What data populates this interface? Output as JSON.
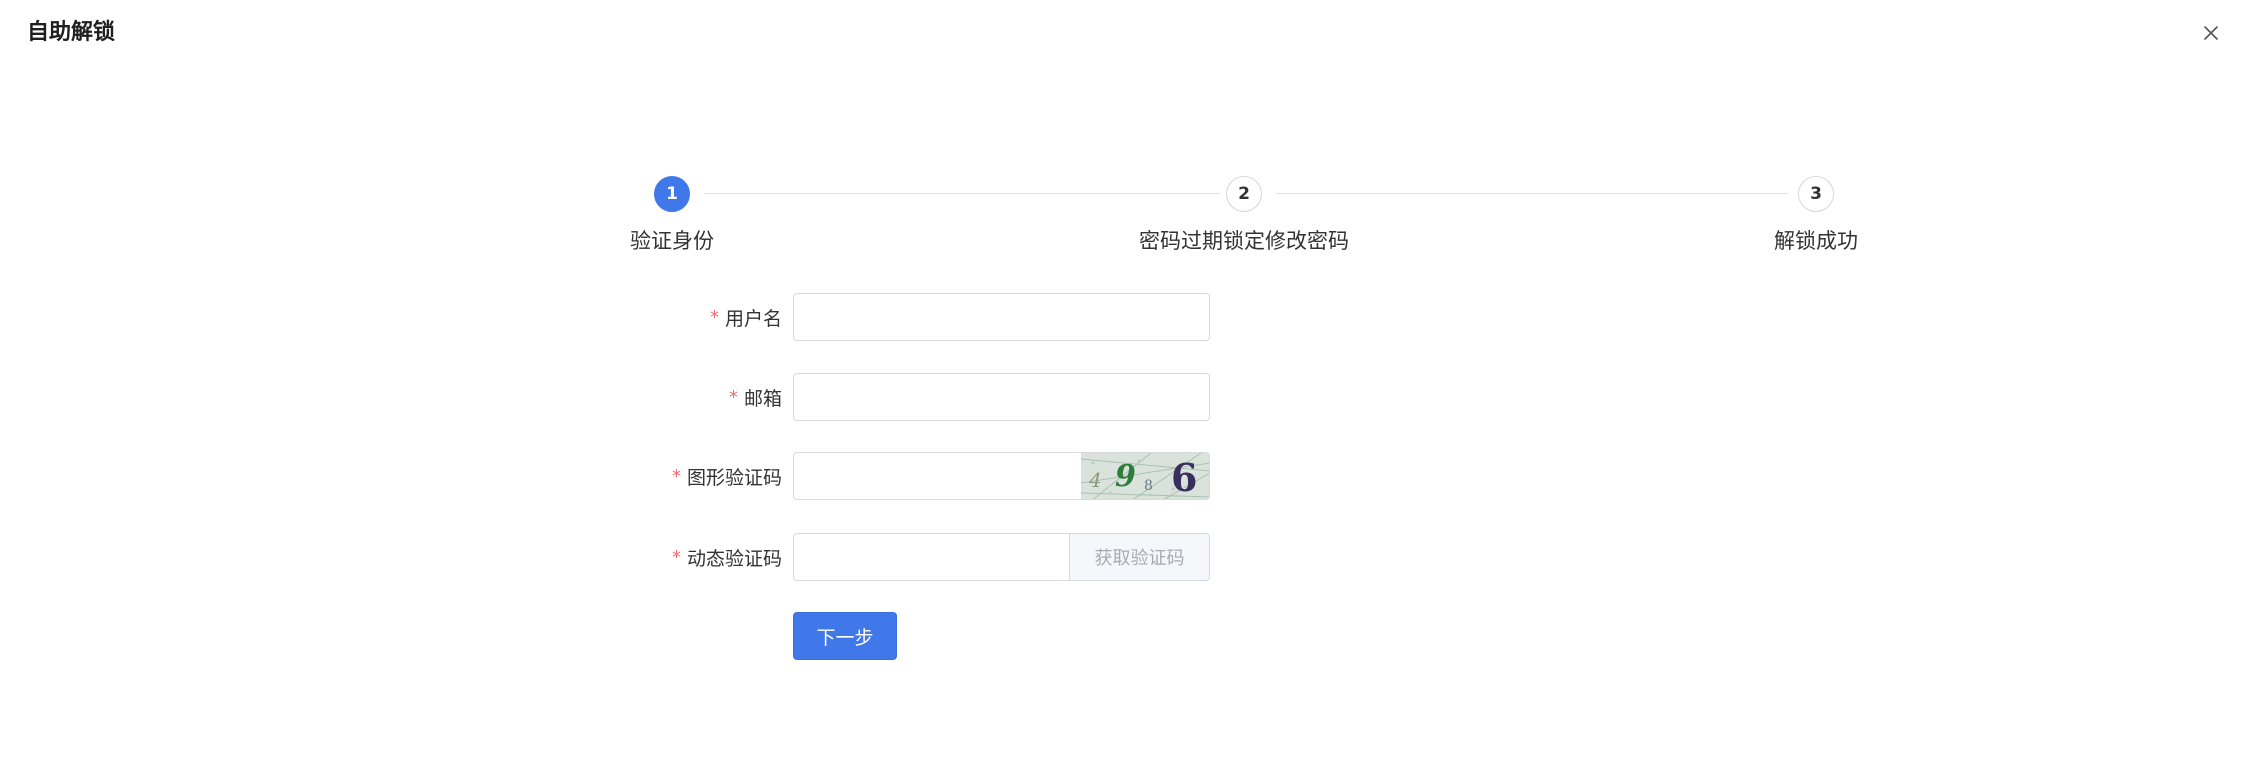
{
  "dialog": {
    "title": "自助解锁"
  },
  "steps": [
    {
      "number": "1",
      "label": "验证身份",
      "state": "active"
    },
    {
      "number": "2",
      "label": "密码过期锁定修改密码",
      "state": "todo"
    },
    {
      "number": "3",
      "label": "解锁成功",
      "state": "todo"
    }
  ],
  "form": {
    "required_mark": "*",
    "username": {
      "label": "用户名",
      "value": "",
      "placeholder": ""
    },
    "email": {
      "label": "邮箱",
      "value": "",
      "placeholder": ""
    },
    "image_captcha": {
      "label": "图形验证码",
      "value": "",
      "placeholder": "",
      "captcha_text": [
        "4",
        "9",
        "8",
        "6"
      ]
    },
    "sms_code": {
      "label": "动态验证码",
      "value": "",
      "placeholder": "",
      "button_label": "获取验证码"
    },
    "next_button": "下一步"
  },
  "colors": {
    "primary": "#4078ea",
    "required": "#f56c6c",
    "border": "#d6d9e0"
  },
  "icons": {
    "close": "close-icon"
  }
}
